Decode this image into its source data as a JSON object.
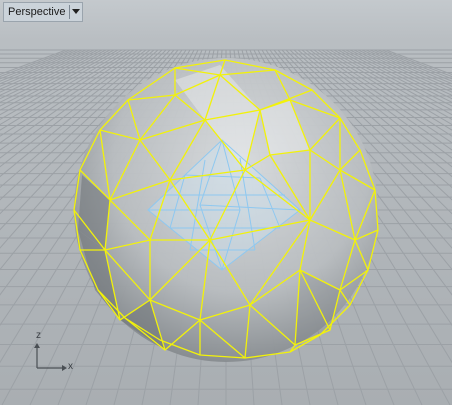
{
  "viewport": {
    "title": "Perspective",
    "dropdown_icon": "triangle-down-icon"
  },
  "axes": {
    "z_label": "z",
    "x_label": "x"
  },
  "colors": {
    "wire_yellow": "#f2f20a",
    "inner_blue": "#8ec8f0"
  }
}
